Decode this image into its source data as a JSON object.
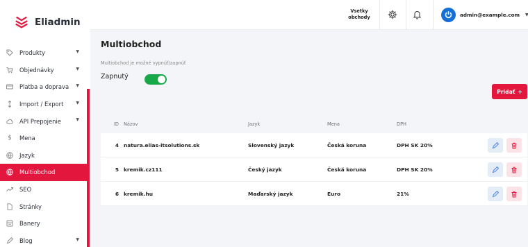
{
  "app": {
    "name": "Eliadmin",
    "accent": "#e3173e"
  },
  "sidebar": {
    "items": [
      {
        "label": "Produkty",
        "icon": "tag-icon",
        "chevron": true,
        "active": false
      },
      {
        "label": "Objednávky",
        "icon": "cart-icon",
        "chevron": true,
        "active": false
      },
      {
        "label": "Platba a doprava",
        "icon": "card-icon",
        "chevron": true,
        "active": false
      },
      {
        "label": "Import / Export",
        "icon": "arrows-updown-icon",
        "chevron": true,
        "active": false
      },
      {
        "label": "API Prepojenie",
        "icon": "cloud-icon",
        "chevron": true,
        "active": false
      },
      {
        "label": "Mena",
        "icon": "dollar-icon",
        "chevron": false,
        "active": false
      },
      {
        "label": "Jazyk",
        "icon": "globe-icon",
        "chevron": false,
        "active": false
      },
      {
        "label": "Multiobchod",
        "icon": "globe-icon",
        "chevron": false,
        "active": true
      },
      {
        "label": "SEO",
        "icon": "trend-icon",
        "chevron": false,
        "active": false
      },
      {
        "label": "Stránky",
        "icon": "page-icon",
        "chevron": false,
        "active": false
      },
      {
        "label": "Banery",
        "icon": "banner-icon",
        "chevron": false,
        "active": false
      },
      {
        "label": "Blog",
        "icon": "pen-icon",
        "chevron": true,
        "active": false
      }
    ]
  },
  "topbar": {
    "stores_line1": "Vsetky",
    "stores_line2": "obchody",
    "user_email": "admin@example.com"
  },
  "main": {
    "title": "Multiobchod",
    "hint": "Multiobchod je možné vypnúť/zapnúť",
    "toggle_label": "Zapnutý",
    "toggle_on": true,
    "add_label": "Pridať",
    "add_symbol": "+"
  },
  "table": {
    "headers": {
      "id": "ID",
      "name": "Názov",
      "lang": "Jazyk",
      "currency": "Mena",
      "vat": "DPH"
    },
    "rows": [
      {
        "id": "4",
        "name": "natura.elias-itsolutions.sk",
        "lang": "Slovenský jazyk",
        "currency": "Česká koruna",
        "vat": "DPH SK 20%"
      },
      {
        "id": "5",
        "name": "kremik.cz111",
        "lang": "Český jazyk",
        "currency": "Česká koruna",
        "vat": "DPH SK 20%"
      },
      {
        "id": "6",
        "name": "kremik.hu",
        "lang": "Maďarský jazyk",
        "currency": "Euro",
        "vat": "21%"
      }
    ]
  }
}
